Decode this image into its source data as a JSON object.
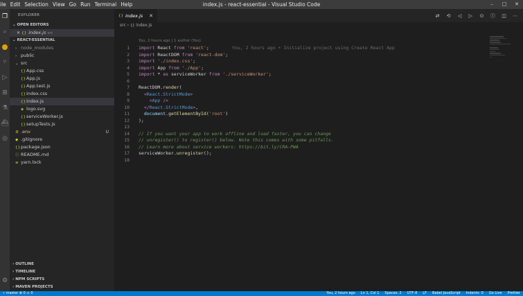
{
  "window": {
    "title": "index.js - react-essential - Visual Studio Code",
    "controls": [
      "–",
      "□",
      "✕"
    ]
  },
  "menu": [
    "ile",
    "Edit",
    "Selection",
    "View",
    "Go",
    "Run",
    "Terminal",
    "Help"
  ],
  "activity_icons": [
    "files-icon",
    "search-icon",
    "history-icon",
    "source-control-icon",
    "run-debug-icon",
    "extensions-icon",
    "test-icon",
    "docker-icon",
    "remote-icon"
  ],
  "sidebar": {
    "title": "EXPLORER",
    "open_editors_label": "OPEN EDITORS",
    "open_editors": [
      {
        "name": "index.js",
        "path": "src",
        "icon": "{}"
      }
    ],
    "project_label": "REACT-ESSENTIAL",
    "tree": [
      {
        "name": "node_modules",
        "type": "folder",
        "depth": 1,
        "muted": true
      },
      {
        "name": "public",
        "type": "folder",
        "depth": 1
      },
      {
        "name": "src",
        "type": "folder-open",
        "depth": 1
      },
      {
        "name": "App.css",
        "type": "file",
        "icon": "{}",
        "depth": 2
      },
      {
        "name": "App.js",
        "type": "file",
        "icon": "{}",
        "depth": 2
      },
      {
        "name": "App.test.js",
        "type": "file",
        "icon": "{}",
        "depth": 2
      },
      {
        "name": "index.css",
        "type": "file",
        "icon": "{}",
        "depth": 2
      },
      {
        "name": "index.js",
        "type": "file",
        "icon": "{}",
        "depth": 2,
        "selected": true
      },
      {
        "name": "logo.svg",
        "type": "file",
        "icon": "◈",
        "depth": 2
      },
      {
        "name": "serviceWorker.js",
        "type": "file",
        "icon": "{}",
        "depth": 2
      },
      {
        "name": "setupTests.js",
        "type": "file",
        "icon": "{}",
        "depth": 2
      },
      {
        "name": ".env",
        "type": "file",
        "icon": "⚙",
        "depth": 1,
        "modified": true,
        "badge": "U"
      },
      {
        "name": ".gitignore",
        "type": "file",
        "icon": "◆",
        "depth": 1
      },
      {
        "name": "package.json",
        "type": "file",
        "icon": "{}",
        "depth": 1
      },
      {
        "name": "README.md",
        "type": "file",
        "icon": "ⓘ",
        "depth": 1
      },
      {
        "name": "yarn.lock",
        "type": "file",
        "icon": "≡",
        "depth": 1
      }
    ],
    "bottom_sections": [
      "OUTLINE",
      "TIMELINE",
      "NPM SCRIPTS",
      "MAVEN PROJECTS"
    ]
  },
  "editor": {
    "tab": {
      "label": "index.js",
      "icon": "{}"
    },
    "breadcrumb": [
      "src",
      "index.js"
    ],
    "blame_header": "You, 2 hours ago | 1 author (You)",
    "blame_inline": "You, 2 hours ago • Initialize project using Create React App",
    "line_numbers": [
      "1",
      "2",
      "3",
      "4",
      "5",
      "6",
      "7",
      "8",
      "9",
      "10",
      "11",
      "12",
      "13",
      "14",
      "15",
      "16",
      "17",
      "18"
    ]
  },
  "statusbar": {
    "left": "⑂ master   ⊗ 0 ⚠ 0",
    "right": [
      "You, 2 hours ago",
      "Ln 1, Col 1",
      "Spaces: 2",
      "UTF-8",
      "LF",
      "Babel JavaScript",
      "Indents: 0",
      "Go Live",
      "Prettier"
    ]
  },
  "colors": {
    "accent": "#007acc",
    "keyword": "#c586c0",
    "string": "#ce9178",
    "comment": "#6a9955",
    "jsx_tag": "#569cd6",
    "function": "#dcdcaa"
  }
}
